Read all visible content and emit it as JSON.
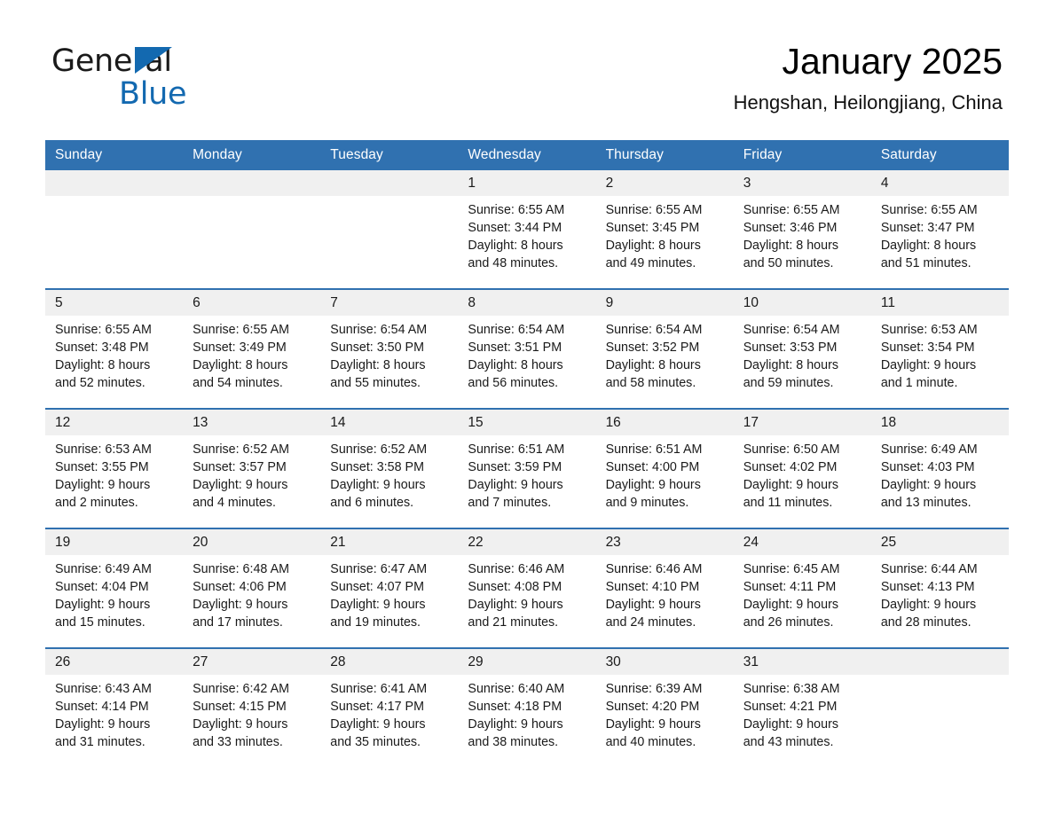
{
  "brand": {
    "line1": "General",
    "line2": "Blue",
    "triangle_color": "#1369b0",
    "text_color": "#1a1a1a"
  },
  "header": {
    "title": "January 2025",
    "subtitle": "Hengshan, Heilongjiang, China"
  },
  "theme": {
    "header_blue": "#3071b0",
    "row_divider_blue": "#3071b0",
    "daynum_band": "#f0f0f0",
    "page_background": "#ffffff"
  },
  "calendar": {
    "weekday_headers": [
      "Sunday",
      "Monday",
      "Tuesday",
      "Wednesday",
      "Thursday",
      "Friday",
      "Saturday"
    ],
    "weeks": [
      [
        {
          "day": "",
          "text": ""
        },
        {
          "day": "",
          "text": ""
        },
        {
          "day": "",
          "text": ""
        },
        {
          "day": "1",
          "text": "Sunrise: 6:55 AM\nSunset: 3:44 PM\nDaylight: 8 hours\nand 48 minutes."
        },
        {
          "day": "2",
          "text": "Sunrise: 6:55 AM\nSunset: 3:45 PM\nDaylight: 8 hours\nand 49 minutes."
        },
        {
          "day": "3",
          "text": "Sunrise: 6:55 AM\nSunset: 3:46 PM\nDaylight: 8 hours\nand 50 minutes."
        },
        {
          "day": "4",
          "text": "Sunrise: 6:55 AM\nSunset: 3:47 PM\nDaylight: 8 hours\nand 51 minutes."
        }
      ],
      [
        {
          "day": "5",
          "text": "Sunrise: 6:55 AM\nSunset: 3:48 PM\nDaylight: 8 hours\nand 52 minutes."
        },
        {
          "day": "6",
          "text": "Sunrise: 6:55 AM\nSunset: 3:49 PM\nDaylight: 8 hours\nand 54 minutes."
        },
        {
          "day": "7",
          "text": "Sunrise: 6:54 AM\nSunset: 3:50 PM\nDaylight: 8 hours\nand 55 minutes."
        },
        {
          "day": "8",
          "text": "Sunrise: 6:54 AM\nSunset: 3:51 PM\nDaylight: 8 hours\nand 56 minutes."
        },
        {
          "day": "9",
          "text": "Sunrise: 6:54 AM\nSunset: 3:52 PM\nDaylight: 8 hours\nand 58 minutes."
        },
        {
          "day": "10",
          "text": "Sunrise: 6:54 AM\nSunset: 3:53 PM\nDaylight: 8 hours\nand 59 minutes."
        },
        {
          "day": "11",
          "text": "Sunrise: 6:53 AM\nSunset: 3:54 PM\nDaylight: 9 hours\nand 1 minute."
        }
      ],
      [
        {
          "day": "12",
          "text": "Sunrise: 6:53 AM\nSunset: 3:55 PM\nDaylight: 9 hours\nand 2 minutes."
        },
        {
          "day": "13",
          "text": "Sunrise: 6:52 AM\nSunset: 3:57 PM\nDaylight: 9 hours\nand 4 minutes."
        },
        {
          "day": "14",
          "text": "Sunrise: 6:52 AM\nSunset: 3:58 PM\nDaylight: 9 hours\nand 6 minutes."
        },
        {
          "day": "15",
          "text": "Sunrise: 6:51 AM\nSunset: 3:59 PM\nDaylight: 9 hours\nand 7 minutes."
        },
        {
          "day": "16",
          "text": "Sunrise: 6:51 AM\nSunset: 4:00 PM\nDaylight: 9 hours\nand 9 minutes."
        },
        {
          "day": "17",
          "text": "Sunrise: 6:50 AM\nSunset: 4:02 PM\nDaylight: 9 hours\nand 11 minutes."
        },
        {
          "day": "18",
          "text": "Sunrise: 6:49 AM\nSunset: 4:03 PM\nDaylight: 9 hours\nand 13 minutes."
        }
      ],
      [
        {
          "day": "19",
          "text": "Sunrise: 6:49 AM\nSunset: 4:04 PM\nDaylight: 9 hours\nand 15 minutes."
        },
        {
          "day": "20",
          "text": "Sunrise: 6:48 AM\nSunset: 4:06 PM\nDaylight: 9 hours\nand 17 minutes."
        },
        {
          "day": "21",
          "text": "Sunrise: 6:47 AM\nSunset: 4:07 PM\nDaylight: 9 hours\nand 19 minutes."
        },
        {
          "day": "22",
          "text": "Sunrise: 6:46 AM\nSunset: 4:08 PM\nDaylight: 9 hours\nand 21 minutes."
        },
        {
          "day": "23",
          "text": "Sunrise: 6:46 AM\nSunset: 4:10 PM\nDaylight: 9 hours\nand 24 minutes."
        },
        {
          "day": "24",
          "text": "Sunrise: 6:45 AM\nSunset: 4:11 PM\nDaylight: 9 hours\nand 26 minutes."
        },
        {
          "day": "25",
          "text": "Sunrise: 6:44 AM\nSunset: 4:13 PM\nDaylight: 9 hours\nand 28 minutes."
        }
      ],
      [
        {
          "day": "26",
          "text": "Sunrise: 6:43 AM\nSunset: 4:14 PM\nDaylight: 9 hours\nand 31 minutes."
        },
        {
          "day": "27",
          "text": "Sunrise: 6:42 AM\nSunset: 4:15 PM\nDaylight: 9 hours\nand 33 minutes."
        },
        {
          "day": "28",
          "text": "Sunrise: 6:41 AM\nSunset: 4:17 PM\nDaylight: 9 hours\nand 35 minutes."
        },
        {
          "day": "29",
          "text": "Sunrise: 6:40 AM\nSunset: 4:18 PM\nDaylight: 9 hours\nand 38 minutes."
        },
        {
          "day": "30",
          "text": "Sunrise: 6:39 AM\nSunset: 4:20 PM\nDaylight: 9 hours\nand 40 minutes."
        },
        {
          "day": "31",
          "text": "Sunrise: 6:38 AM\nSunset: 4:21 PM\nDaylight: 9 hours\nand 43 minutes."
        },
        {
          "day": "",
          "text": ""
        }
      ]
    ]
  }
}
